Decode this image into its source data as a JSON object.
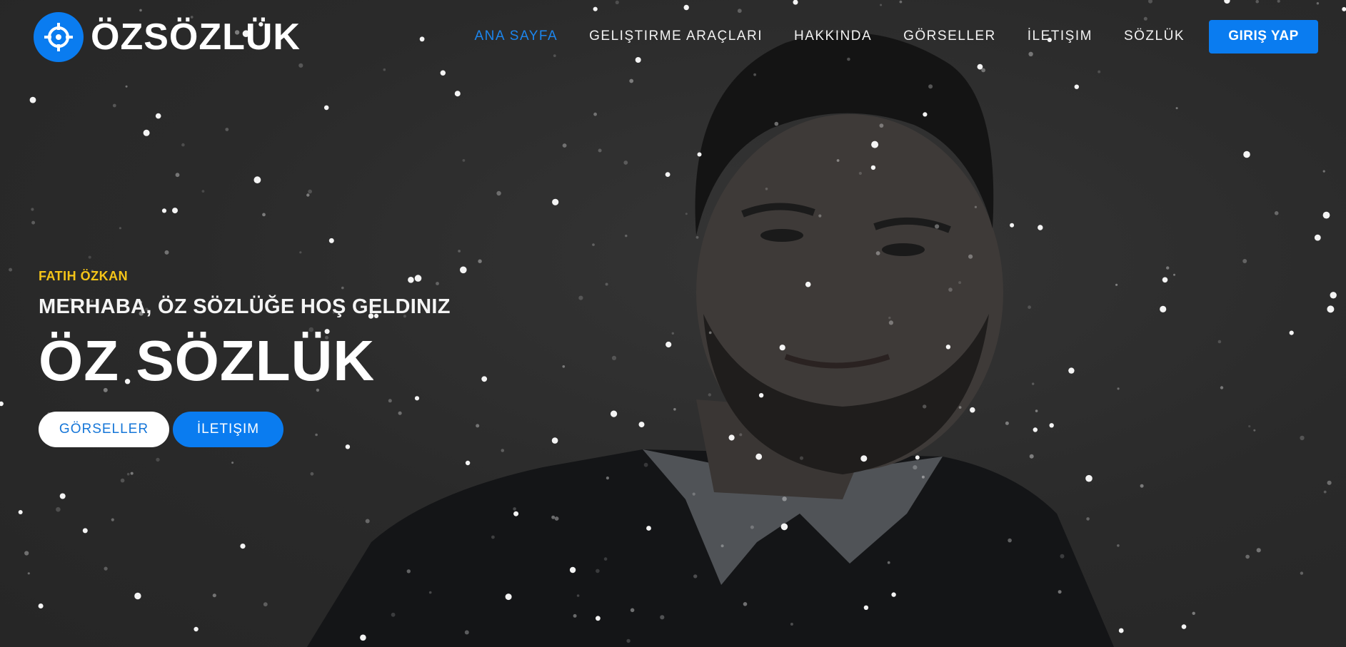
{
  "brand": {
    "name": "ÖZSÖZLÜK",
    "logo_icon": "crosshair-icon"
  },
  "nav": {
    "items": [
      {
        "label": "ANA SAYFA",
        "active": true
      },
      {
        "label": "GELIŞTIRME ARAÇLARI",
        "active": false
      },
      {
        "label": "HAKKINDA",
        "active": false
      },
      {
        "label": "GÖRSELLER",
        "active": false
      },
      {
        "label": "İLETIŞIM",
        "active": false
      },
      {
        "label": "SÖZLÜK",
        "active": false
      }
    ],
    "login_label": "GIRIŞ YAP"
  },
  "hero": {
    "kicker": "FATIH ÖZKAN",
    "subtitle": "MERHABA, ÖZ SÖZLÜĞE HOŞ GELDINIZ",
    "title": "ÖZ SÖZLÜK",
    "primary_button": "GÖRSELLER",
    "secondary_button": "İLETIŞIM"
  },
  "colors": {
    "accent": "#0a7cf0",
    "kicker": "#f5c518",
    "background": "#2b2b2b"
  }
}
